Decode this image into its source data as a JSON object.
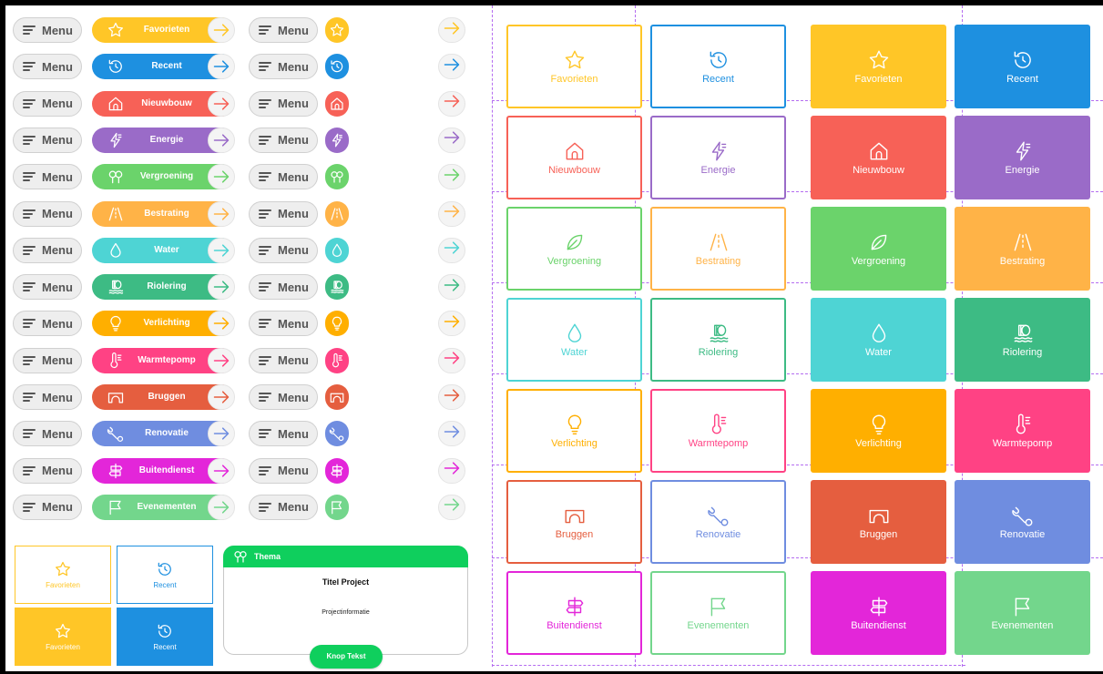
{
  "menu_label": "Menu",
  "rows": [
    {
      "label": "Favorieten",
      "icon": "star-icon",
      "color": "#FFC627"
    },
    {
      "label": "Recent",
      "icon": "history-icon",
      "color": "#1E90E0"
    },
    {
      "label": "Nieuwbouw",
      "icon": "house-icon",
      "color": "#F76157"
    },
    {
      "label": "Energie",
      "icon": "lightning-icon",
      "color": "#9A6BC8"
    },
    {
      "label": "Vergroening",
      "icon": "trees-icon",
      "color": "#6BD36B"
    },
    {
      "label": "Bestrating",
      "icon": "road-icon",
      "color": "#FFB347"
    },
    {
      "label": "Water",
      "icon": "drop-icon",
      "color": "#4ED4D4"
    },
    {
      "label": "Riolering",
      "icon": "sewer-icon",
      "color": "#3DBB84"
    },
    {
      "label": "Verlichting",
      "icon": "bulb-icon",
      "color": "#FFAF00"
    },
    {
      "label": "Warmtepomp",
      "icon": "thermometer-icon",
      "color": "#FF4284"
    },
    {
      "label": "Bruggen",
      "icon": "bridge-icon",
      "color": "#E55E3F"
    },
    {
      "label": "Renovatie",
      "icon": "wrench-icon",
      "color": "#6F8DE0"
    },
    {
      "label": "Buitendienst",
      "icon": "signpost-icon",
      "color": "#E326D9"
    },
    {
      "label": "Evenementen",
      "icon": "flag-icon",
      "color": "#73D68C"
    }
  ],
  "mini_cards": [
    {
      "label": "Favorieten",
      "icon": "star-icon",
      "color": "#FFC627"
    },
    {
      "label": "Recent",
      "icon": "history-icon",
      "color": "#1E90E0"
    }
  ],
  "project_card": {
    "theme_label": "Thema",
    "icon": "trees-icon",
    "title": "Titel Project",
    "info": "Projectinformatie",
    "button": "Knop Tekst",
    "color": "#0FCF5D"
  },
  "tiles": [
    {
      "label": "Favorieten",
      "icon": "star-icon",
      "color": "#FFC627"
    },
    {
      "label": "Recent",
      "icon": "history-icon",
      "color": "#1E90E0"
    },
    {
      "label": "Nieuwbouw",
      "icon": "house-icon",
      "color": "#F76157"
    },
    {
      "label": "Energie",
      "icon": "lightning-icon",
      "color": "#9A6BC8"
    },
    {
      "label": "Vergroening",
      "icon": "leaf-icon",
      "color": "#6BD36B"
    },
    {
      "label": "Bestrating",
      "icon": "road-icon",
      "color": "#FFB347"
    },
    {
      "label": "Water",
      "icon": "drop-icon",
      "color": "#4ED4D4"
    },
    {
      "label": "Riolering",
      "icon": "sewer-icon",
      "color": "#3DBB84"
    },
    {
      "label": "Verlichting",
      "icon": "bulb-icon",
      "color": "#FFAF00"
    },
    {
      "label": "Warmtepomp",
      "icon": "thermometer-icon",
      "color": "#FF4284"
    },
    {
      "label": "Bruggen",
      "icon": "bridge-icon",
      "color": "#E55E3F"
    },
    {
      "label": "Renovatie",
      "icon": "wrench-icon",
      "color": "#6F8DE0"
    },
    {
      "label": "Buitendienst",
      "icon": "signpost-icon",
      "color": "#E326D9"
    },
    {
      "label": "Evenementen",
      "icon": "flag-icon",
      "color": "#73D68C"
    }
  ]
}
